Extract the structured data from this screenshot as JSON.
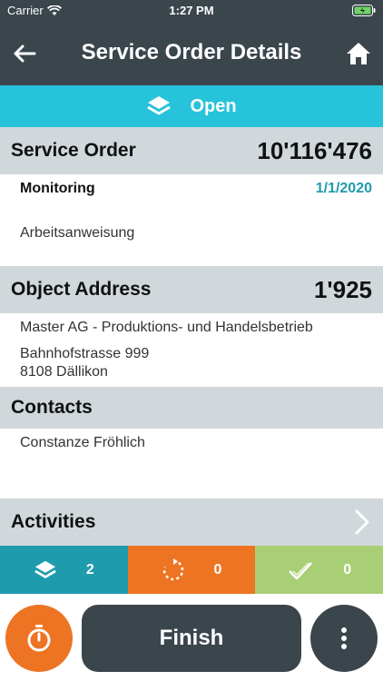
{
  "status_bar": {
    "carrier": "Carrier",
    "time": "1:27 PM"
  },
  "nav": {
    "title": "Service Order Details"
  },
  "status": {
    "label": "Open"
  },
  "service_order": {
    "label": "Service Order",
    "number": "10'116'476",
    "type": "Monitoring",
    "date": "1/1/2020",
    "instruction": "Arbeitsanweisung"
  },
  "object_address": {
    "label": "Object Address",
    "number": "1'925",
    "company": "Master AG - Produktions- und Handelsbetrieb",
    "street": "Bahnhofstrasse 999",
    "city": "8108 Dällikon"
  },
  "contacts": {
    "label": "Contacts",
    "name": "Constanze Fröhlich"
  },
  "activities": {
    "label": "Activities"
  },
  "counters": {
    "layers_count": "2",
    "in_progress_count": "0",
    "done_count": "0"
  },
  "actions": {
    "finish_label": "Finish"
  },
  "colors": {
    "nav_bg": "#3a454c",
    "status_open": "#26c3da",
    "section_bg": "#d0d8dc",
    "date_accent": "#1f9bae",
    "counter_blue": "#1f9bae",
    "counter_orange": "#ed7422",
    "counter_green": "#a9cf76"
  }
}
